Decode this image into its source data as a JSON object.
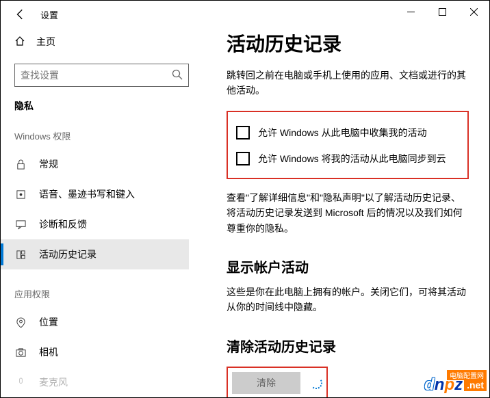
{
  "window": {
    "title": "设置"
  },
  "sidebar": {
    "home_label": "主页",
    "search_placeholder": "查找设置",
    "group_label": "隐私",
    "section1_heading": "Windows 权限",
    "section2_heading": "应用权限",
    "items": [
      {
        "label": "常规"
      },
      {
        "label": "语音、墨迹书写和键入"
      },
      {
        "label": "诊断和反馈"
      },
      {
        "label": "活动历史记录"
      }
    ],
    "app_items": [
      {
        "label": "位置"
      },
      {
        "label": "相机"
      },
      {
        "label": "麦克风"
      }
    ]
  },
  "content": {
    "title": "活动历史记录",
    "intro": "跳转回之前在电脑或手机上使用的应用、文档或进行的其他活动。",
    "checkbox1": "允许 Windows 从此电脑中收集我的活动",
    "checkbox2": "允许 Windows 将我的活动从此电脑同步到云",
    "learn_more": "查看\"了解详细信息\"和\"隐私声明\"以了解活动历史记录、将活动历史记录发送到 Microsoft 后的情况以及我们如何尊重你的隐私。",
    "show_activity_title": "显示帐户活动",
    "show_activity_desc": "这些是你在此电脑上拥有的帐户。关闭它们，可将其活动从你的时间线中隐藏。",
    "clear_title": "清除活动历史记录",
    "clear_btn": "清除"
  },
  "watermark": {
    "text": "dnpz",
    "suffix": ".net",
    "sub": "电脑配置网"
  }
}
